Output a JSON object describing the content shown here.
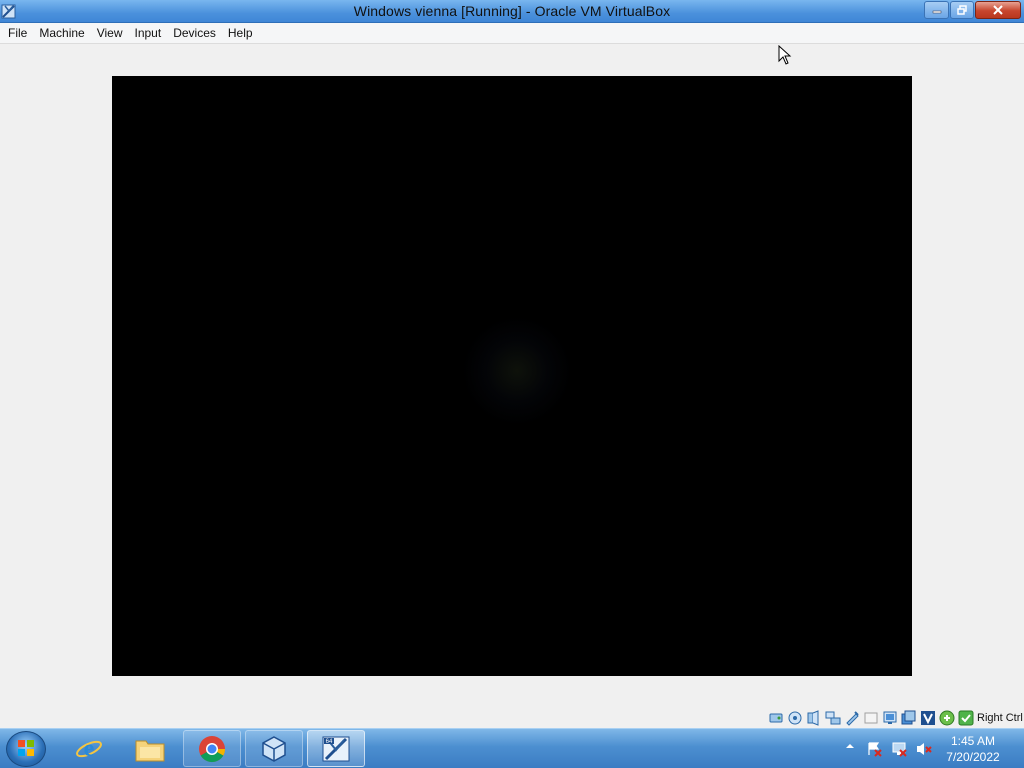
{
  "window": {
    "title": "Windows vienna [Running] - Oracle VM VirtualBox",
    "app_icon": "virtualbox-icon"
  },
  "menu": {
    "items": [
      "File",
      "Machine",
      "View",
      "Input",
      "Devices",
      "Help"
    ]
  },
  "vm": {
    "state": "Running",
    "screen_color": "#000000"
  },
  "statusbar": {
    "icons": [
      "hard-disk-icon",
      "optical-drive-icon",
      "audio-icon",
      "network-icon",
      "usb-icon",
      "shared-folders-icon",
      "display-icon",
      "video-capture-icon",
      "cpu-virtualization-icon",
      "mouse-integration-icon",
      "keyboard-icon"
    ],
    "host_key": "Right Ctrl"
  },
  "taskbar": {
    "start_icon": "windows-start-icon",
    "apps": [
      "internet-explorer-icon",
      "file-explorer-icon",
      "chrome-icon",
      "virtualbox-icon",
      "virtualbox-vm-icon"
    ],
    "tray": [
      "show-hidden-icons-chevron",
      "action-center-icon",
      "network-icon",
      "volume-muted-icon"
    ],
    "time": "1:45 AM",
    "date": "7/20/2022"
  }
}
